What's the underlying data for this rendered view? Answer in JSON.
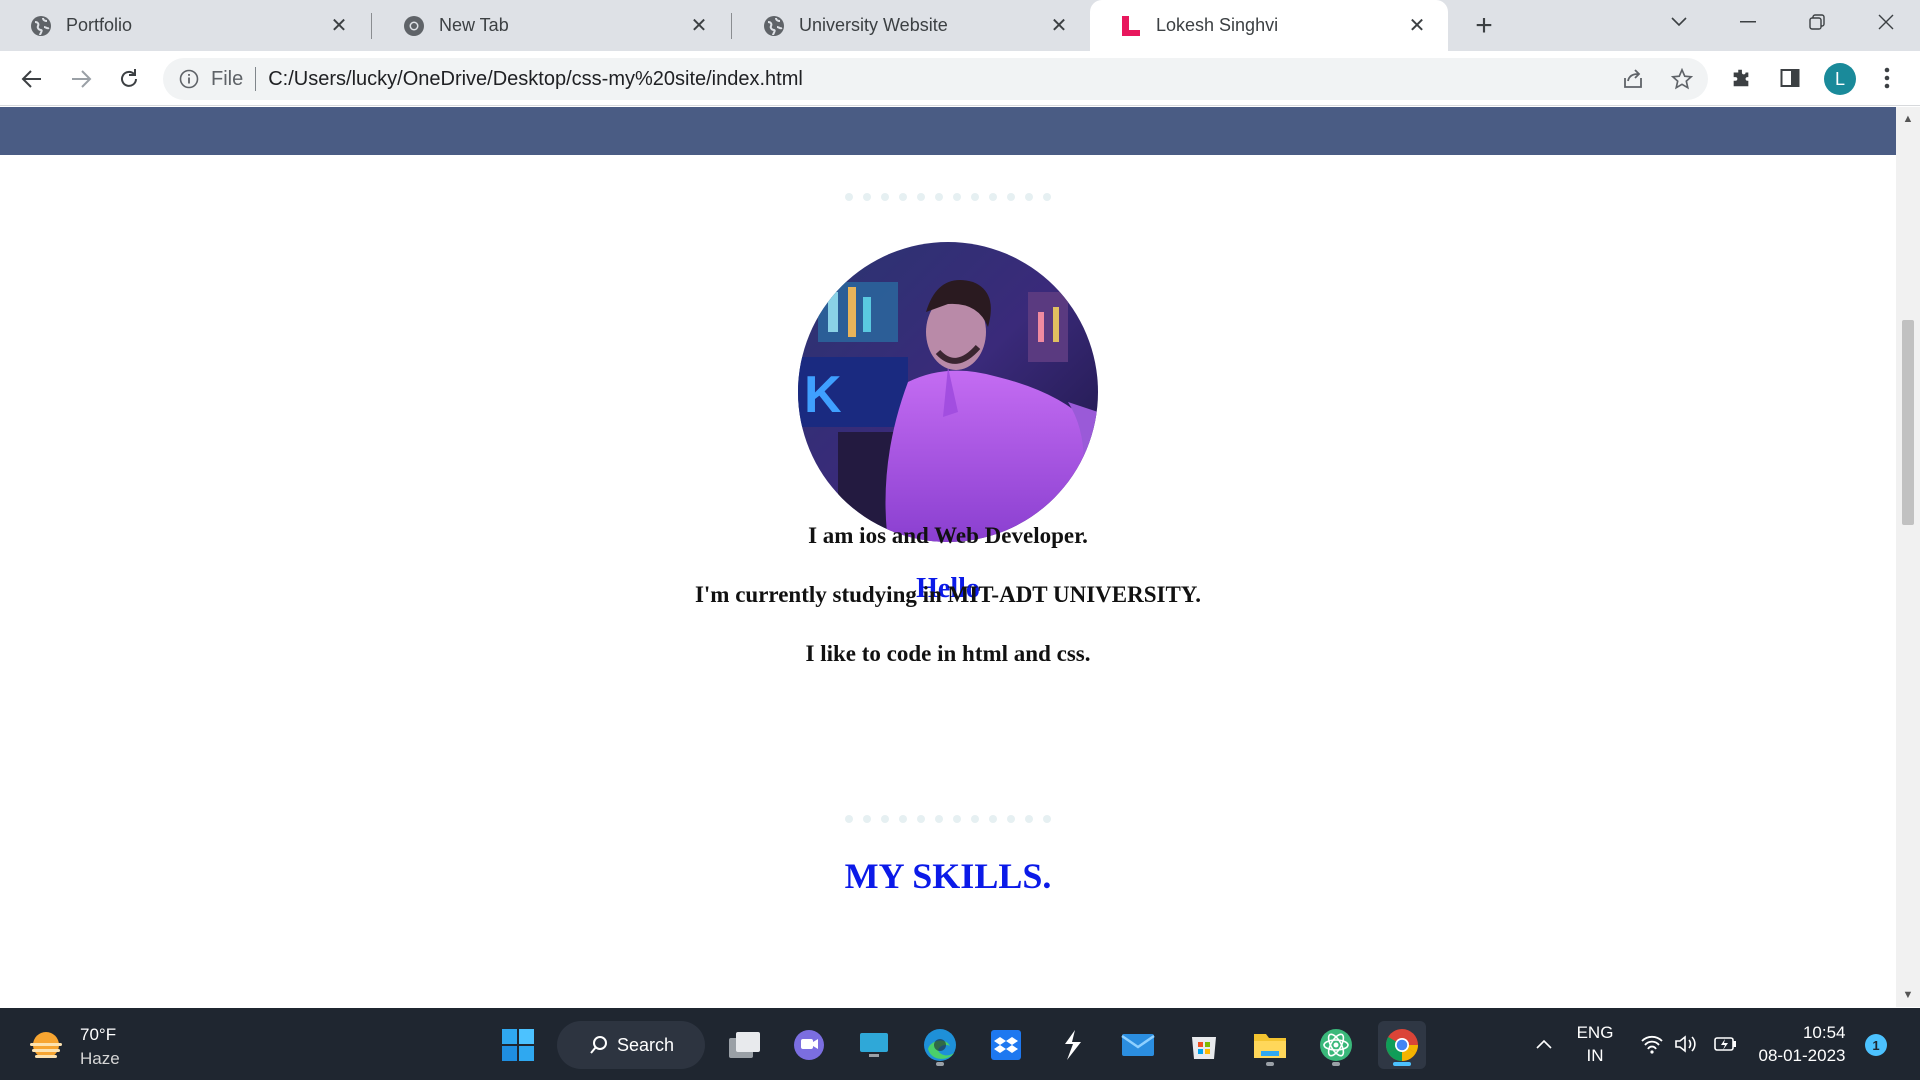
{
  "browser": {
    "tabs": [
      {
        "title": "Portfolio",
        "icon": "globe-icon",
        "active": false
      },
      {
        "title": "New Tab",
        "icon": "chrome-icon",
        "active": false
      },
      {
        "title": "University Website",
        "icon": "globe-icon",
        "active": false
      },
      {
        "title": "Lokesh Singhvi",
        "icon": "L-logo-icon",
        "active": true
      }
    ],
    "address": {
      "scheme_label": "File",
      "url": "C:/Users/lucky/OneDrive/Desktop/css-my%20site/index.html"
    },
    "profile_initial": "L"
  },
  "page": {
    "hello": "Hello",
    "lines": [
      "I am ios and Web Developer.",
      "I'm currently studying in MIT-ADT UNIVERSITY.",
      "I like to code in html and css."
    ],
    "skills_heading": "MY SKILLS.",
    "colors": {
      "header_bar": "#4a5c84",
      "heading_blue": "#0b1ae8",
      "dots": "#e6f0f2"
    }
  },
  "taskbar": {
    "weather": {
      "temp": "70°F",
      "condition": "Haze"
    },
    "search_label": "Search",
    "language": {
      "line1": "ENG",
      "line2": "IN"
    },
    "clock": {
      "time": "10:54",
      "date": "08-01-2023"
    },
    "notification_count": "1"
  }
}
